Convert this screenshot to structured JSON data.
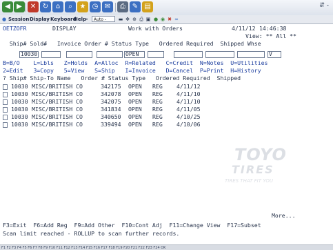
{
  "toolbar": {
    "buttons": [
      {
        "icon": "back-icon",
        "color": "#3a8a3a",
        "glyph": "◀"
      },
      {
        "icon": "forward-icon",
        "color": "#3a8a3a",
        "glyph": "▶"
      },
      {
        "icon": "stop-icon",
        "color": "#c0392b",
        "glyph": "✕"
      },
      {
        "icon": "refresh-icon",
        "color": "#3b6fc2",
        "glyph": "↻"
      },
      {
        "icon": "home-icon",
        "color": "#3b6fc2",
        "glyph": "⌂"
      },
      {
        "icon": "search-icon",
        "color": "#3b6fc2",
        "glyph": "⌕"
      },
      {
        "icon": "favorites-icon",
        "color": "#d3a21c",
        "glyph": "★"
      },
      {
        "icon": "history-icon",
        "color": "#3b6fc2",
        "glyph": "◷"
      },
      {
        "icon": "mail-icon",
        "color": "#3b6fc2",
        "glyph": "✉"
      },
      {
        "icon": "print-icon",
        "color": "#5b6b82",
        "glyph": "⎙"
      },
      {
        "icon": "edit-icon",
        "color": "#3b6fc2",
        "glyph": "✎"
      },
      {
        "icon": "folder-icon",
        "color": "#d3a21c",
        "glyph": "▤"
      }
    ],
    "right_glyph": "⇵ -"
  },
  "menubar": {
    "items": [
      "Session",
      "Display",
      "Keyboard",
      "Help"
    ],
    "auto_value": "Auto -"
  },
  "screen": {
    "program": "OETZOFR",
    "mode": "DISPLAY",
    "title": "Work with Orders",
    "date": "4/11/12",
    "time": "14:46:38",
    "view_text": "View: ** All **",
    "filter_headers": "  Ship# Sold#   Invoice Order # Status Type   Ordered Required  Shipped Whse",
    "filters": {
      "ship": "10030",
      "sold": "",
      "invoice": "",
      "order": "",
      "status": "OPEN",
      "type": "",
      "ordered": "",
      "required": "",
      "shipped": "",
      "whse": "V"
    },
    "options_line1": "B=B/O    L=Lbls   Z=Holds  A=Alloc  R=Related   C=Credit  N=Notes  U=Utilities",
    "options_line2": "2=Edit   3=Copy   5=View   S=Ship   I=Invoice   D=Cancel  P=Print  H=History",
    "list_header": "? Ship# Ship-To Name   Order # Status Type   Ordered Required  Shipped",
    "rows": [
      {
        "ship": "10030",
        "name": "MISC/BRITISH CO",
        "order": "342175",
        "status": "OPEN",
        "type": "REG",
        "ordered": "4/11/12"
      },
      {
        "ship": "10030",
        "name": "MISC/BRITISH CO",
        "order": "342078",
        "status": "OPEN",
        "type": "REG",
        "ordered": "4/11/10"
      },
      {
        "ship": "10030",
        "name": "MISC/BRITISH CO",
        "order": "342075",
        "status": "OPEN",
        "type": "REG",
        "ordered": "4/11/10"
      },
      {
        "ship": "10030",
        "name": "MISC/BRITISH CO",
        "order": "341834",
        "status": "OPEN",
        "type": "REG",
        "ordered": "4/11/05"
      },
      {
        "ship": "10030",
        "name": "MISC/BRITISH CO",
        "order": "340650",
        "status": "OPEN",
        "type": "REG",
        "ordered": "4/10/25"
      },
      {
        "ship": "10030",
        "name": "MISC/BRITISH CO",
        "order": "339494",
        "status": "OPEN",
        "type": "REG",
        "ordered": "4/10/06"
      }
    ],
    "more": "More...",
    "fkeys": "F3=Exit  F6=Add Reg  F9=Add Other  F10=Cont Adj  F11=Change View  F17=Subset",
    "message": "Scan limit reached - ROLLUP to scan further records.",
    "watermark": {
      "brand": "TOYO",
      "brand2": "TIRES",
      "tagline": "TIRES THAT FIT YOU"
    }
  },
  "fstrip": "F1 F2 F3 F4 F5 F6 F7 F8 F9 F10 F11 F12 F13 F14 F15 F16 F17 F18 F19 F20 F21 F22 F23 F24 OK"
}
